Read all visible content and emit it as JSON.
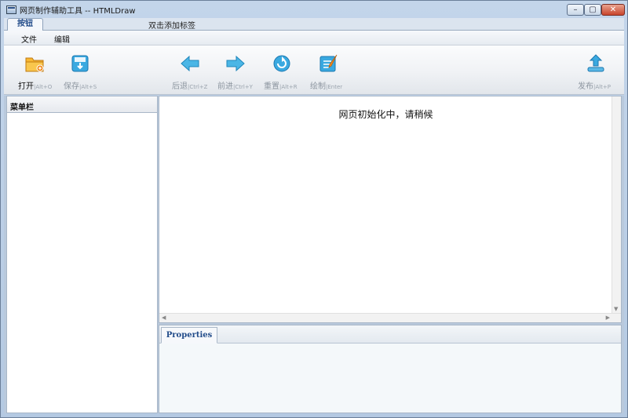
{
  "window": {
    "title": "网页制作辅助工具 -- HTMLDraw"
  },
  "tabs": {
    "active": "按钮",
    "add_hint": "双击添加标签"
  },
  "menu": {
    "file": "文件",
    "edit": "编辑"
  },
  "toolbar": [
    {
      "icon": "open-folder-icon",
      "label": "打开",
      "shortcut": "|Alt+O"
    },
    {
      "icon": "save-icon",
      "label": "保存",
      "shortcut": "|Alt+S"
    },
    {
      "icon": "back-arrow-icon",
      "label": "后退",
      "shortcut": "|Ctrl+Z"
    },
    {
      "icon": "forward-arrow-icon",
      "label": "前进",
      "shortcut": "|Ctrl+Y"
    },
    {
      "icon": "reset-icon",
      "label": "重置",
      "shortcut": "|Alt+R"
    },
    {
      "icon": "draw-icon",
      "label": "绘制",
      "shortcut": "|Enter"
    },
    {
      "icon": "publish-icon",
      "label": "发布",
      "shortcut": "|Alt+P"
    }
  ],
  "left_panel": {
    "title": "菜单栏"
  },
  "browser": {
    "status": "网页初始化中，请稍候"
  },
  "properties": {
    "tab": "Properties"
  },
  "colors": {
    "accent": "#224c8a",
    "icon_orange": "#f0a020",
    "icon_blue": "#2a9fd8"
  }
}
